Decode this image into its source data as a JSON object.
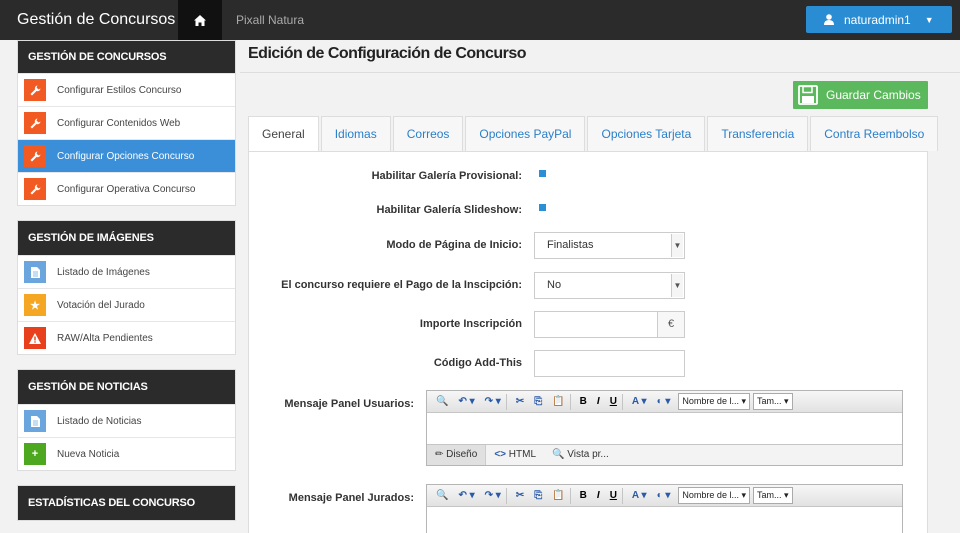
{
  "header": {
    "brand": "Gestión de Concursos",
    "site_name": "Pixall Natura",
    "user": "naturadmin1"
  },
  "sidebar": {
    "panels": [
      {
        "title": "GESTIÓN DE CONCURSOS",
        "items": [
          {
            "label": "Configurar Estilos Concurso",
            "icon": "wrench-icon",
            "active": false
          },
          {
            "label": "Configurar Contenidos Web",
            "icon": "wrench-icon",
            "active": false
          },
          {
            "label": "Configurar Opciones Concurso",
            "icon": "wrench-icon",
            "active": true
          },
          {
            "label": "Configurar Operativa Concurso",
            "icon": "wrench-icon",
            "active": false
          }
        ]
      },
      {
        "title": "GESTIÓN DE IMÁGENES",
        "items": [
          {
            "label": "Listado de Imágenes",
            "icon": "document-icon"
          },
          {
            "label": "Votación del Jurado",
            "icon": "star-icon"
          },
          {
            "label": "RAW/Alta Pendientes",
            "icon": "warning-icon"
          }
        ]
      },
      {
        "title": "GESTIÓN DE NOTICIAS",
        "items": [
          {
            "label": "Listado de Noticias",
            "icon": "document-icon"
          },
          {
            "label": "Nueva Noticia",
            "icon": "plus-icon"
          }
        ]
      },
      {
        "title": "ESTADÍSTICAS DEL CONCURSO",
        "items": []
      }
    ]
  },
  "main": {
    "title": "Edición de Configuración de Concurso",
    "save_label": "Guardar Cambios",
    "tabs": [
      {
        "label": "General",
        "active": true
      },
      {
        "label": "Idiomas"
      },
      {
        "label": "Correos"
      },
      {
        "label": "Opciones PayPal"
      },
      {
        "label": "Opciones Tarjeta"
      },
      {
        "label": "Transferencia"
      },
      {
        "label": "Contra Reembolso"
      }
    ],
    "form": {
      "galeria_provisional_label": "Habilitar Galería Provisional:",
      "galeria_slideshow_label": "Habilitar Galería Slideshow:",
      "modo_pagina_label": "Modo de Página de Inicio:",
      "modo_pagina_value": "Finalistas",
      "pago_label": "El concurso requiere el Pago de la Inscipción:",
      "pago_value": "No",
      "importe_label": "Importe Inscripción",
      "importe_addon": "€",
      "addthis_label": "Código Add-This",
      "panel_usuarios_label": "Mensaje Panel Usuarios:",
      "panel_jurados_label": "Mensaje Panel Jurados:"
    },
    "editor": {
      "font_select": "Nombre de l...",
      "size_select": "Tam...",
      "mode_design": "Diseño",
      "mode_html": "HTML",
      "mode_preview": "Vista pr..."
    }
  },
  "colors": {
    "topbar": "#2b2b2b",
    "accent_blue": "#3b8fd8",
    "save_green": "#5cb85c",
    "icon_orange": "#f15a22"
  }
}
